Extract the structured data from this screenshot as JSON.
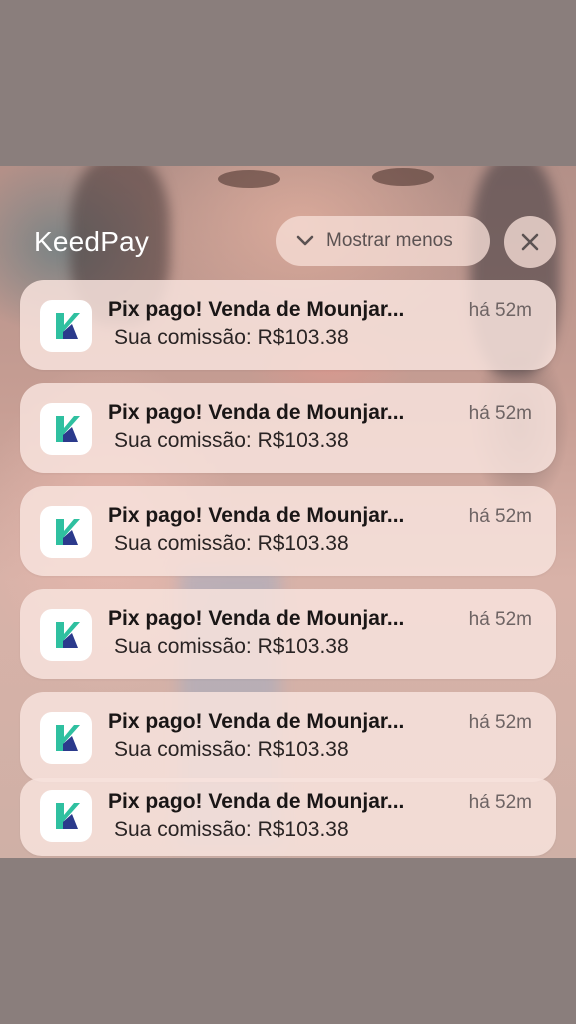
{
  "header": {
    "app_name": "KeedPay",
    "collapse_label": "Mostrar menos"
  },
  "notifications": [
    {
      "title": "Pix pago! Venda de Mounjar...",
      "body": "Sua comissão: R$103.38",
      "time": "há 52m"
    },
    {
      "title": "Pix pago! Venda de Mounjar...",
      "body": "Sua comissão: R$103.38",
      "time": "há 52m"
    },
    {
      "title": "Pix pago! Venda de Mounjar...",
      "body": "Sua comissão: R$103.38",
      "time": "há 52m"
    },
    {
      "title": "Pix pago! Venda de Mounjar...",
      "body": "Sua comissão: R$103.38",
      "time": "há 52m"
    },
    {
      "title": "Pix pago! Venda de Mounjar...",
      "body": "Sua comissão: R$103.38",
      "time": "há 52m"
    },
    {
      "title": "Pix pago! Venda de Mounjar...",
      "body": "Sua comissão: R$103.38",
      "time": "há 52m"
    }
  ],
  "icons": {
    "app_icon": "keedpay-logo-icon",
    "collapse": "chevron-down-icon",
    "close": "close-icon"
  },
  "colors": {
    "page_background": "#8a7e7c",
    "card_background": "#f7e2dc",
    "logo_teal": "#2fc0a0",
    "logo_navy": "#2b3a8c"
  }
}
